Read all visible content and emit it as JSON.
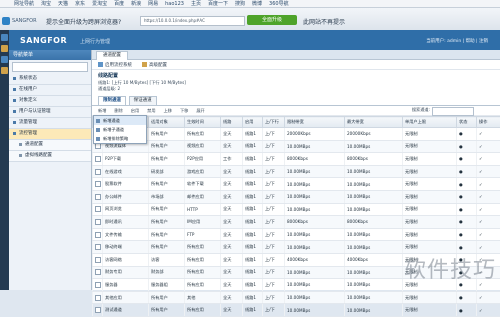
{
  "bookmarks": [
    "网址导航",
    "淘宝",
    "天猫",
    "京东",
    "爱淘宝",
    "百度",
    "新浪",
    "网易",
    "hao123",
    "主页",
    "百度一下",
    "搜狗",
    "微博",
    "360导航"
  ],
  "browser": {
    "brand": "SANGFOR",
    "promo": "提示全面升级为跨屏浏览器?",
    "address": "https://10.0.0.1/index.php#AC",
    "green_button": "全面升级",
    "ask": "此网站不再提示"
  },
  "app": {
    "logo": "SANGFOR",
    "product": "上网行为管理",
    "user": "当前用户: admin  |  帮助  |  注销"
  },
  "sidebar": {
    "title": "导航菜单",
    "items": [
      {
        "label": "系统状态",
        "sub": false,
        "active": false
      },
      {
        "label": "在线用户",
        "sub": false,
        "active": false
      },
      {
        "label": "对象定义",
        "sub": false,
        "active": false
      },
      {
        "label": "用户与认证管理",
        "sub": false,
        "active": false
      },
      {
        "label": "流量管理",
        "sub": false,
        "active": false
      },
      {
        "label": "流控管理",
        "sub": false,
        "active": true
      },
      {
        "label": "通道配置",
        "sub": true,
        "active": false
      },
      {
        "label": "虚拟线路配置",
        "sub": true,
        "active": false
      }
    ]
  },
  "main": {
    "tab": "通道配置",
    "toolbar": [
      "启用流控系统",
      "高级配置"
    ],
    "info_title": "线路配置",
    "info_line1": "线路1: [上行 10 M/Bytes] [下行 10 M/Bytes]",
    "info_line2": "通道层级: 2",
    "inner_tabs": [
      "限制通道",
      "保证通道"
    ],
    "toolbar2": [
      "新增",
      "删除",
      "启用",
      "禁用",
      "上移",
      "下移",
      "展开"
    ],
    "filter_label": "搜索通道:"
  },
  "table": {
    "headers": [
      "",
      "通道 - 用户名",
      "适用对象",
      "生效时间",
      "线路",
      "启用",
      "上/下行",
      "限制带宽",
      "最大带宽",
      "单用户上限",
      "状态",
      "操作"
    ],
    "rows": [
      [
        "",
        "默认通道",
        "所有用户",
        "所有应用",
        "全天",
        "线路1",
        "上/下",
        "20000Kbps",
        "20000Kbps",
        "无限制",
        "●",
        "✓"
      ],
      [
        "",
        "视频流媒体",
        "所有用户",
        "视频应用",
        "全天",
        "线路1",
        "上/下",
        "10.00MBps",
        "10.00MBps",
        "无限制",
        "●",
        "✓"
      ],
      [
        "",
        "P2P下载",
        "所有用户",
        "P2P应用",
        "工作",
        "线路1",
        "上/下",
        "8000Kbps",
        "8000Kbps",
        "无限制",
        "●",
        "✓"
      ],
      [
        "",
        "在线游戏",
        "研发部",
        "游戏应用",
        "全天",
        "线路1",
        "上/下",
        "10.00MBps",
        "10.00MBps",
        "无限制",
        "●",
        "✓"
      ],
      [
        "",
        "股票软件",
        "所有用户",
        "软件下载",
        "全天",
        "线路1",
        "上/下",
        "10.00MBps",
        "10.00MBps",
        "无限制",
        "●",
        "✓"
      ],
      [
        "",
        "办公邮件",
        "市场部",
        "邮件应用",
        "全天",
        "线路1",
        "上/下",
        "10.00MBps",
        "10.00MBps",
        "无限制",
        "●",
        "✓"
      ],
      [
        "",
        "网页浏览",
        "所有用户",
        "HTTP",
        "全天",
        "线路1",
        "上/下",
        "10.00MBps",
        "10.00MBps",
        "无限制",
        "●",
        "✓"
      ],
      [
        "",
        "即时通讯",
        "所有用户",
        "IM应用",
        "全天",
        "线路1",
        "上/下",
        "8000Kbps",
        "8000Kbps",
        "无限制",
        "●",
        "✓"
      ],
      [
        "",
        "文件传输",
        "所有用户",
        "FTP",
        "全天",
        "线路1",
        "上/下",
        "10.00MBps",
        "10.00MBps",
        "无限制",
        "●",
        "✓"
      ],
      [
        "",
        "移动终端",
        "所有用户",
        "所有应用",
        "全天",
        "线路1",
        "上/下",
        "10.00MBps",
        "10.00MBps",
        "无限制",
        "●",
        "✓"
      ],
      [
        "",
        "访客网络",
        "访客",
        "所有应用",
        "全天",
        "线路1",
        "上/下",
        "4000Kbps",
        "4000Kbps",
        "无限制",
        "●",
        "✓"
      ],
      [
        "",
        "财务专用",
        "财务部",
        "所有应用",
        "全天",
        "线路1",
        "上/下",
        "10.00MBps",
        "10.00MBps",
        "无限制",
        "●",
        "✓"
      ],
      [
        "",
        "服务器",
        "服务器组",
        "所有应用",
        "全天",
        "线路1",
        "上/下",
        "10.00MBps",
        "10.00MBps",
        "无限制",
        "●",
        "✓"
      ],
      [
        "",
        "其他应用",
        "所有用户",
        "其他",
        "全天",
        "线路1",
        "上/下",
        "10.00MBps",
        "10.00MBps",
        "无限制",
        "●",
        "✓"
      ],
      [
        "",
        "测试通道",
        "所有用户",
        "所有应用",
        "全天",
        "线路1",
        "上/下",
        "10.00MBps",
        "10.00MBps",
        "无限制",
        "●",
        "✓"
      ]
    ]
  },
  "context_menu": [
    "新增通道",
    "新增子通道",
    "新增排除策略"
  ],
  "watermark": "软件技巧"
}
